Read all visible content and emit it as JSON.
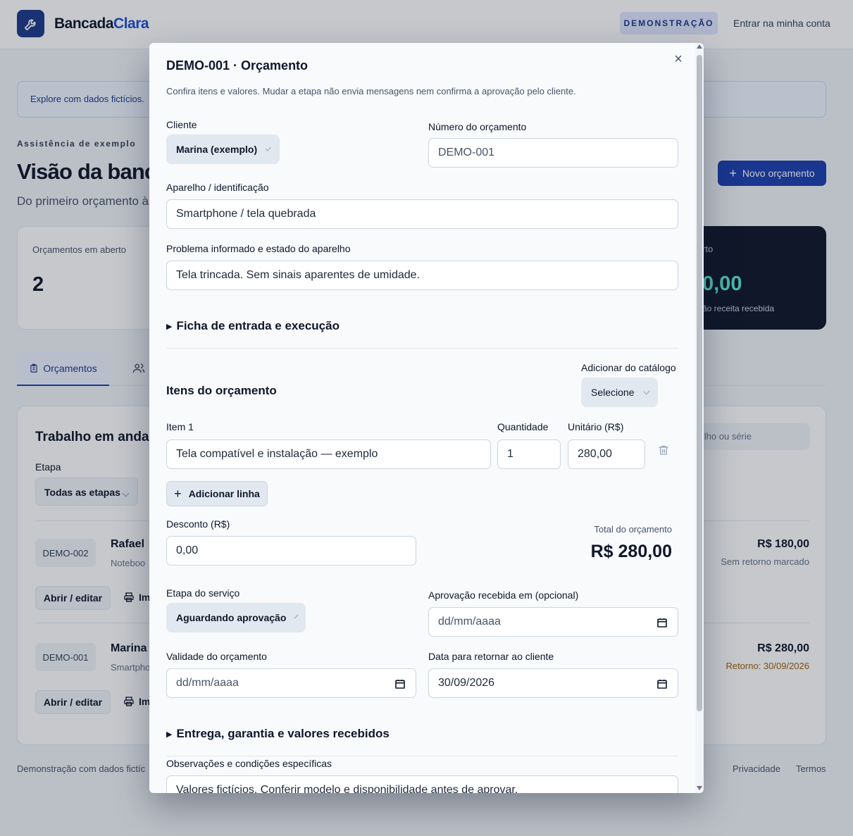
{
  "app": {
    "brand_part1": "Bancada",
    "brand_part2": "Clara",
    "demo_badge": "DEMONSTRAÇÃO",
    "login_link": "Entrar na minha conta",
    "accent_color": "#1e40af"
  },
  "background": {
    "banner_text": "Explore com dados fictícios.",
    "eyebrow": "Assistência de exemplo",
    "title": "Visão da banc",
    "subtitle": "Do primeiro orçamento à",
    "new_button": "Novo orçamento",
    "stat_open_label": "Orçamentos em aberto",
    "stat_open_value": "2",
    "stat_dark_label": "rto",
    "stat_dark_value": "0,00",
    "stat_dark_sub": "ão receita recebida",
    "tab_active": "Orçamentos",
    "work_title": "Trabalho em andar",
    "filter_label": "Etapa",
    "filter_value": "Todas as etapas",
    "search_placeholder": "arelho ou série",
    "rows": [
      {
        "id": "DEMO-002",
        "name": "Rafael",
        "device": "Noteboo",
        "amount": "R$ 180,00",
        "note": "Sem retorno marcado",
        "open": "Abrir / editar",
        "print": "Im"
      },
      {
        "id": "DEMO-001",
        "name": "Marina",
        "device": "Smartpho",
        "amount": "R$ 280,00",
        "note": "Retorno: 30/09/2026",
        "open": "Abrir / editar",
        "print": "Im"
      }
    ],
    "footer_left": "Demonstração com dados fictíc",
    "footer_privacy": "Privacidade",
    "footer_terms": "Termos"
  },
  "modal": {
    "title": "DEMO-001 · Orçamento",
    "subtitle": "Confira itens e valores. Mudar a etapa não envia mensagens nem confirma a aprovação pelo cliente.",
    "client_label": "Cliente",
    "client_value": "Marina (exemplo)",
    "quote_number_label": "Número do orçamento",
    "quote_number_value": "DEMO-001",
    "device_label": "Aparelho / identificação",
    "device_value": "Smartphone / tela quebrada",
    "problem_label": "Problema informado e estado do aparelho",
    "problem_value": "Tela trincada. Sem sinais aparentes de umidade.",
    "section_entry": "Ficha de entrada e execução",
    "items_title": "Itens do orçamento",
    "catalog_label": "Adicionar do catálogo",
    "catalog_value": "Selecione",
    "item_label": "Item 1",
    "qty_label": "Quantidade",
    "unit_label": "Unitário (R$)",
    "item_value": "Tela compatível e instalação — exemplo",
    "qty_value": "1",
    "unit_value": "280,00",
    "add_line": "Adicionar linha",
    "discount_label": "Desconto (R$)",
    "discount_value": "0,00",
    "total_label": "Total do orçamento",
    "total_value": "R$ 280,00",
    "stage_label": "Etapa do serviço",
    "stage_value": "Aguardando aprovação",
    "approval_label": "Aprovação recebida em (opcional)",
    "approval_value": "dd/mm/aaaa",
    "validity_label": "Validade do orçamento",
    "validity_value": "dd/mm/aaaa",
    "return_label": "Data para retornar ao cliente",
    "return_value": "30/09/2026",
    "section_delivery": "Entrega, garantia e valores recebidos",
    "notes_label": "Observações e condições específicas",
    "notes_value": "Valores fictícios. Conferir modelo e disponibilidade antes de aprovar.",
    "close": "×"
  }
}
